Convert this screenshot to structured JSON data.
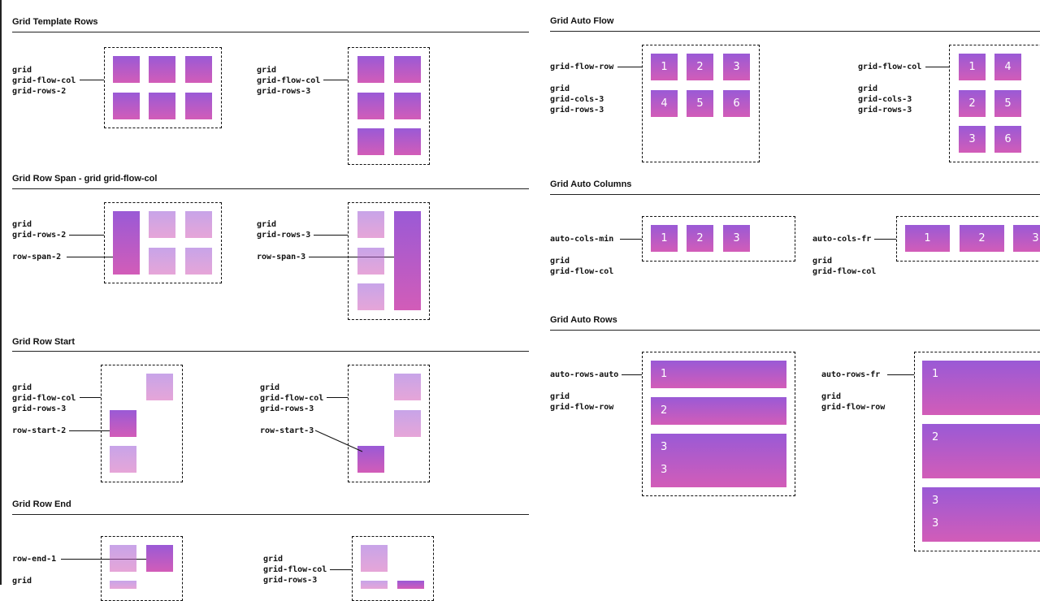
{
  "sections": {
    "grid_template_rows": "Grid Template Rows",
    "grid_row_span": "Grid Row Span - grid grid-flow-col",
    "grid_row_start": "Grid Row Start",
    "grid_row_end": "Grid Row End",
    "grid_auto_flow": "Grid Auto Flow",
    "grid_auto_columns": "Grid Auto Columns",
    "grid_auto_rows": "Grid Auto Rows"
  },
  "labels": {
    "grid": "grid",
    "grid_flow_col": "grid-flow-col",
    "grid_flow_row": "grid-flow-row",
    "grid_rows_2": "grid-rows-2",
    "grid_rows_3": "grid-rows-3",
    "grid_cols_3": "grid-cols-3",
    "row_span_2": "row-span-2",
    "row_span_3": "row-span-3",
    "row_start_2": "row-start-2",
    "row_start_3": "row-start-3",
    "row_end_1": "row-end-1",
    "auto_cols_min": "auto-cols-min",
    "auto_cols_fr": "auto-cols-fr",
    "auto_rows_auto": "auto-rows-auto",
    "auto_rows_fr": "auto-rows-fr"
  },
  "cells": {
    "n1": "1",
    "n2": "2",
    "n3": "3",
    "n4": "4",
    "n5": "5",
    "n6": "6"
  },
  "colors": {
    "cell_top": "#9a5ad6",
    "cell_bottom": "#d25cb8",
    "rule": "#222222"
  }
}
